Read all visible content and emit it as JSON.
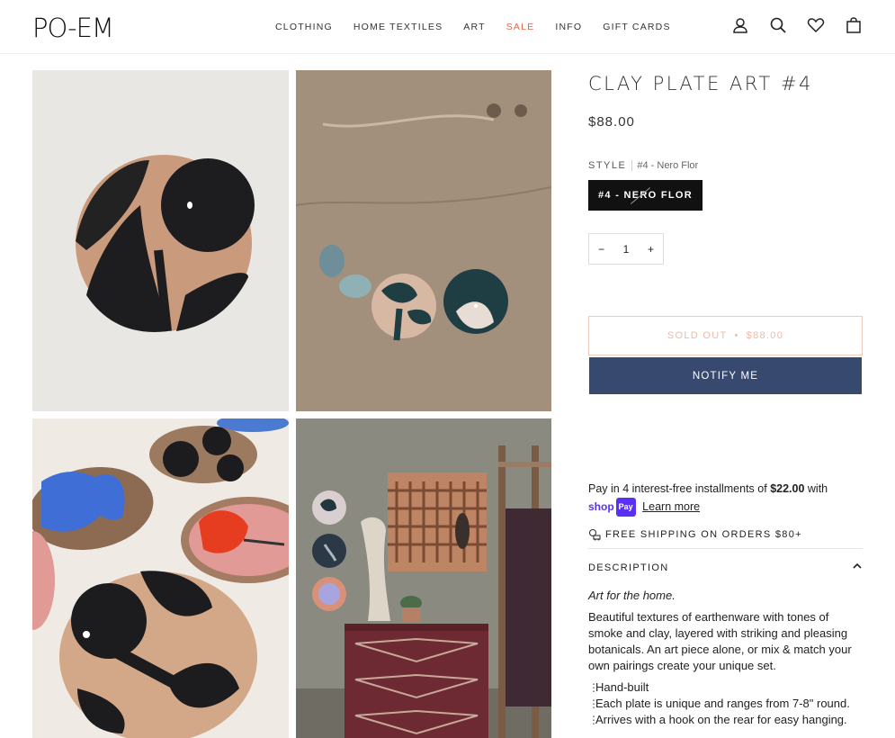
{
  "brand": {
    "logo": "PO-EM"
  },
  "nav": {
    "items": [
      "CLOTHING",
      "HOME TEXTILES",
      "ART",
      "SALE",
      "INFO",
      "GIFT CARDS"
    ]
  },
  "header_icons": [
    "account-icon",
    "search-icon",
    "heart-icon",
    "bag-icon"
  ],
  "product": {
    "title": "CLAY PLATE ART #4",
    "price": "$88.00",
    "style_label": "STYLE",
    "style_value": "#4 - Nero Flor",
    "swatch_label": "#4 - NERO FLOR",
    "qty_minus": "−",
    "qty_value": "1",
    "qty_plus": "+",
    "soldout_text": "SOLD OUT",
    "soldout_sep": "•",
    "soldout_price": "$88.00",
    "notify_label": "NOTIFY ME"
  },
  "installments": {
    "prefix": "Pay in 4 interest-free installments of",
    "amount": "$22.00",
    "suffix": "with",
    "shop": "shop",
    "pay": "Pay",
    "learn_more": "Learn more"
  },
  "shipping": {
    "text": "FREE SHIPPING ON ORDERS $80+"
  },
  "description": {
    "heading": "DESCRIPTION",
    "tagline": "Art for the home.",
    "body": "Beautiful textures of earthenware with tones of smoke and clay, layered with striking and pleasing botanicals. An art piece alone, or mix & match your own pairings create your unique set.",
    "bullets": [
      "Hand-built",
      "Each plate is unique and ranges from 7-8\" round.",
      "Arrives with a hook on the rear for easy hanging."
    ]
  },
  "colors": {
    "sale": "#d86a4a",
    "notify": "#38496f",
    "soldout": "#f0b9a6",
    "shoppay": "#5a31f4"
  }
}
